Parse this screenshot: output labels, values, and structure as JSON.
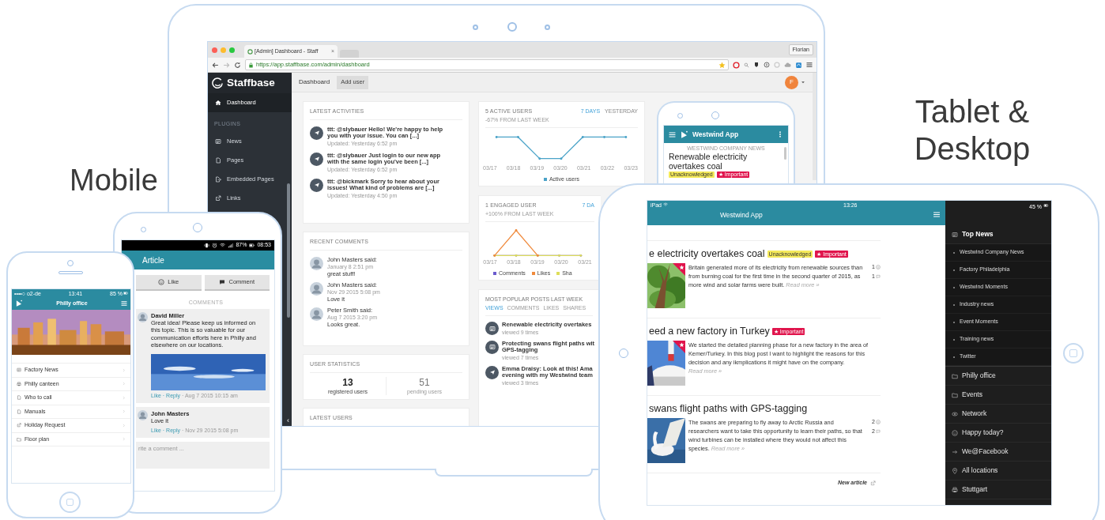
{
  "headings": {
    "mobile": "Mobile",
    "desktop": [
      "Tablet &",
      "Desktop"
    ]
  },
  "laptop": {
    "browser": {
      "tab_title": "[Admin] Dashboard - Staff",
      "tab_close": "×",
      "profile": "Florian",
      "url": "https://app.staffbase.com/admin/dashboard"
    },
    "sidebar": {
      "brand": "Staffbase",
      "main": [
        {
          "label": "Dashboard",
          "kind": "home",
          "selected": true
        }
      ],
      "section": "PLUGINS",
      "plugins": [
        {
          "label": "News",
          "kind": "news",
          "selected": false
        },
        {
          "label": "Pages",
          "kind": "doc",
          "selected": false
        },
        {
          "label": "Embedded Pages",
          "kind": "embed",
          "selected": false
        },
        {
          "label": "Links",
          "kind": "link",
          "selected": false
        }
      ],
      "collapse": "‹"
    },
    "topbar": {
      "title": "Dashboard",
      "button": "Add user",
      "avatar": "F"
    },
    "activities": {
      "title": "LATEST ACTIVITIES",
      "items": [
        {
          "text": "ttt: @slybauer Hello! We're happy to help you with your issue. You can [...]",
          "time": "Updated: Yesterday 6:52 pm"
        },
        {
          "text": "ttt: @slybauer Just login to our new app with the same login you've been [...]",
          "time": "Updated: Yesterday 6:52 pm"
        },
        {
          "text": "ttt: @bickmark Sorry to hear about your issues! What kind of problems are [...]",
          "time": "Updated: Yesterday 4:50 pm"
        }
      ]
    },
    "comments": {
      "title": "RECENT COMMENTS",
      "items": [
        {
          "author": "John Masters said:",
          "date": "January 8 2:51 pm",
          "text": "great stuff!"
        },
        {
          "author": "John Masters said:",
          "date": "Nov 29 2015 5:08 pm",
          "text": "Love it"
        },
        {
          "author": "Peter Smith said:",
          "date": "Aug 7 2015 3:20 pm",
          "text": "Looks great."
        }
      ]
    },
    "stats": {
      "title": "USER STATISTICS",
      "items": [
        {
          "value": "13",
          "label": "registered users",
          "kind": "strong"
        },
        {
          "value": "51",
          "label": "pending users",
          "kind": "muted"
        }
      ]
    },
    "latest_users": {
      "title": "LATEST USERS"
    },
    "active_users": {
      "title": "5 ACTIVE USERS",
      "subtitle": "-67% FROM LAST WEEK",
      "ranges": [
        {
          "label": "7 DAYS",
          "selected": true
        },
        {
          "label": "YESTERDAY",
          "selected": false
        }
      ],
      "x_labels": [
        "03/17",
        "03/18",
        "03/19",
        "03/20",
        "03/21",
        "03/22",
        "03/23"
      ],
      "legend": [
        {
          "label": "Active users",
          "color": "#4aa3c8"
        }
      ]
    },
    "engaged_users": {
      "title": "1 ENGAGED USER",
      "subtitle": "+100% FROM LAST WEEK",
      "range": "7 DA",
      "x_labels": [
        "03/17",
        "03/18",
        "03/19",
        "03/20",
        "03/21"
      ],
      "legend": [
        {
          "label": "Comments",
          "color": "#6a5acd"
        },
        {
          "label": "Likes",
          "color": "#f08a3c"
        },
        {
          "label": "Sha",
          "color": "#dede5a"
        }
      ]
    },
    "popular": {
      "title": "MOST POPULAR POSTS LAST WEEK",
      "filters": [
        {
          "label": "VIEWS",
          "selected": true
        },
        {
          "label": "COMMENTS",
          "selected": false
        },
        {
          "label": "LIKES",
          "selected": false
        },
        {
          "label": "SHARES",
          "selected": false
        }
      ],
      "items": [
        {
          "kind": "article",
          "title": "Renewable electricity overtakes",
          "views": "viewed 9 times"
        },
        {
          "kind": "article",
          "title": "Protecting swans flight paths wit\nGPS-tagging",
          "views": "viewed 7 times"
        },
        {
          "kind": "post",
          "title": "Emma Draisy: Look at this! Ama\nevening with my Westwind team",
          "views": "viewed 3 times"
        }
      ]
    },
    "preview": {
      "app_title": "Westwind App",
      "section": "WESTWIND COMPANY NEWS",
      "title": "Renewable electricity overtakes coal",
      "badges": [
        {
          "kind": "unacknowledged",
          "label": "Unacknowledged"
        },
        {
          "kind": "important",
          "label": "★ Important"
        }
      ]
    }
  },
  "android": {
    "battery": "87%",
    "time": "08:53",
    "title": "Article",
    "buttons": [
      {
        "label": "Like",
        "kind": "like"
      },
      {
        "label": "Comment",
        "kind": "comment"
      }
    ],
    "comments_title": "COMMENTS",
    "comments": [
      {
        "author": "David Miller",
        "text": "Great idea! Please keep us informed on this topic. This is so valuable for our communication efforts here in Philly and elsewhere on our locations.",
        "has_picture": true,
        "actions": [
          "Like",
          "· Reply"
        ],
        "date": "· Aug 7 2015 10:15 am"
      },
      {
        "author": "John Masters",
        "text": "Love it",
        "has_picture": false,
        "actions": [
          "Like",
          "· Reply"
        ],
        "date": "· Nov 29 2015 5:08 pm"
      }
    ],
    "input": {
      "placeholder": "rite a comment ..."
    }
  },
  "iphone": {
    "carrier": "••••○ o2-de",
    "time": "13:41",
    "battery": "85 %",
    "title": "Philly office",
    "items": [
      {
        "label": "Factory News",
        "kind": "news"
      },
      {
        "label": "Philly canteen",
        "kind": "printer"
      },
      {
        "label": "Who to call",
        "kind": "doc"
      },
      {
        "label": "Manuals",
        "kind": "doc"
      },
      {
        "label": "Holiday Request",
        "kind": "link"
      },
      {
        "label": "Floor plan",
        "kind": "folder"
      }
    ]
  },
  "tablet": {
    "device": "iPad",
    "time": "13:26",
    "battery": "45 %",
    "title": "Westwind App",
    "articles": [
      {
        "title": "e electricity overtakes coal",
        "badges": [
          {
            "kind": "unacknowledged",
            "label": "Unacknowledged"
          },
          {
            "kind": "important",
            "label": "★ Important"
          }
        ],
        "text": "Britain generated more of its electricity from renewable sources than from burning coal for the first time in the second quarter of 2015, as more wind and solar farms were built.",
        "read_more": "Read more »",
        "counts": [
          {
            "kind": "likes",
            "value": "1"
          },
          {
            "kind": "comments",
            "value": "1"
          }
        ]
      },
      {
        "title": "eed a new factory in Turkey",
        "badges": [
          {
            "kind": "important",
            "label": "★ Important"
          }
        ],
        "text": "We started the detailed planning phase for a new factory in the area of Kemer/Turkey. In this blog post I want to highlight the reasons for this decision and any ikmplications it might have on the company.",
        "read_more": "Read more »"
      },
      {
        "title": "swans flight paths with GPS-tagging",
        "text": "The swans are preparing to fly away to Arctic Russia and researchers want to take this opportunity to learn their paths, so that wind turbines can be installed where they would not affect this species.",
        "read_more": "Read more »",
        "counts": [
          {
            "kind": "likes",
            "value": "2"
          },
          {
            "kind": "comments",
            "value": "2"
          }
        ]
      }
    ],
    "new_article": "New article",
    "menu": [
      {
        "label": "Top News",
        "kind": "news",
        "children": [
          {
            "label": "Westwind Company News"
          },
          {
            "label": "Factory Philadelphia"
          },
          {
            "label": "Westwind Moments"
          },
          {
            "label": "Industry news"
          },
          {
            "label": "Event Moments"
          },
          {
            "label": "Training news"
          },
          {
            "label": "Twitter"
          }
        ]
      },
      {
        "label": "Philly office",
        "kind": "folder"
      },
      {
        "label": "Events",
        "kind": "folder"
      },
      {
        "label": "Network",
        "kind": "network"
      },
      {
        "label": "Happy today?",
        "kind": "smiley"
      },
      {
        "label": "We@Facebook",
        "kind": "arrow"
      },
      {
        "label": "All locations",
        "kind": "pin"
      },
      {
        "label": "Stuttgart",
        "kind": "printer"
      }
    ]
  }
}
